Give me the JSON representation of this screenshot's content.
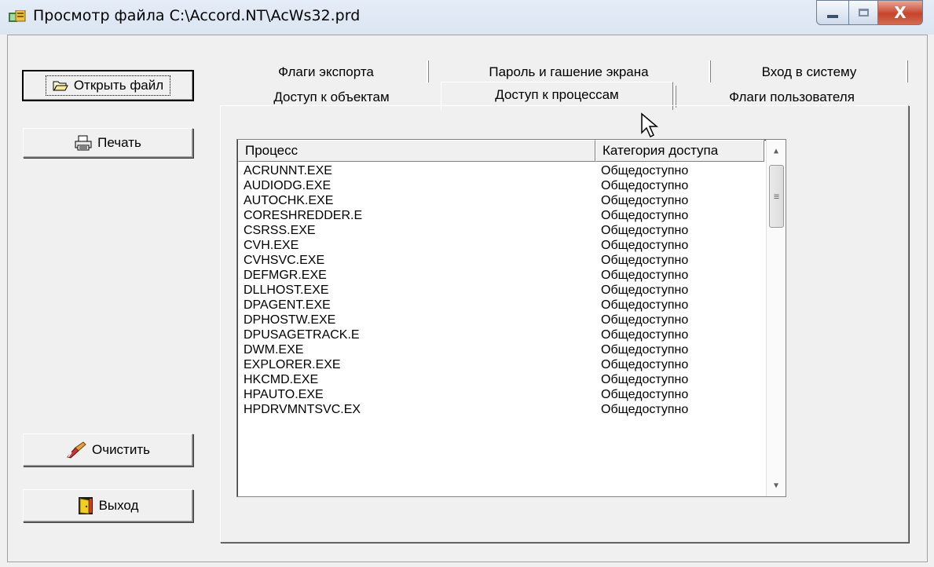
{
  "window": {
    "title": "Просмотр файла C:\\Accord.NT\\AcWs32.prd",
    "close_glyph": "X"
  },
  "buttons": {
    "open_file": "Открыть файл",
    "print": "Печать",
    "clear": "Очистить",
    "exit": "Выход"
  },
  "tabs": {
    "row_top": [
      "Флаги экспорта",
      "Пароль и гашение экрана",
      "Вход в систему"
    ],
    "row_bottom": [
      "Доступ к объектам",
      "Доступ к процессам",
      "Флаги пользователя"
    ],
    "active": "Доступ к процессам"
  },
  "list": {
    "columns": [
      "Процесс",
      "Категория доступа"
    ],
    "rows": [
      [
        "ACRUNNT.EXE",
        "Общедоступно"
      ],
      [
        "AUDIODG.EXE",
        "Общедоступно"
      ],
      [
        "AUTOCHK.EXE",
        "Общедоступно"
      ],
      [
        "CORESHREDDER.E",
        "Общедоступно"
      ],
      [
        "CSRSS.EXE",
        "Общедоступно"
      ],
      [
        "CVH.EXE",
        "Общедоступно"
      ],
      [
        "CVHSVC.EXE",
        "Общедоступно"
      ],
      [
        "DEFMGR.EXE",
        "Общедоступно"
      ],
      [
        "DLLHOST.EXE",
        "Общедоступно"
      ],
      [
        "DPAGENT.EXE",
        "Общедоступно"
      ],
      [
        "DPHOSTW.EXE",
        "Общедоступно"
      ],
      [
        "DPUSAGETRACK.E",
        "Общедоступно"
      ],
      [
        "DWM.EXE",
        "Общедоступно"
      ],
      [
        "EXPLORER.EXE",
        "Общедоступно"
      ],
      [
        "HKCMD.EXE",
        "Общедоступно"
      ],
      [
        "HPAUTO.EXE",
        "Общедоступно"
      ],
      [
        "HPDRVMNTSVC.EX",
        "Общедоступно"
      ]
    ]
  },
  "icons": {
    "open": "folder-open-icon",
    "print": "printer-icon",
    "clear": "eraser-icon",
    "exit": "door-exit-icon"
  }
}
